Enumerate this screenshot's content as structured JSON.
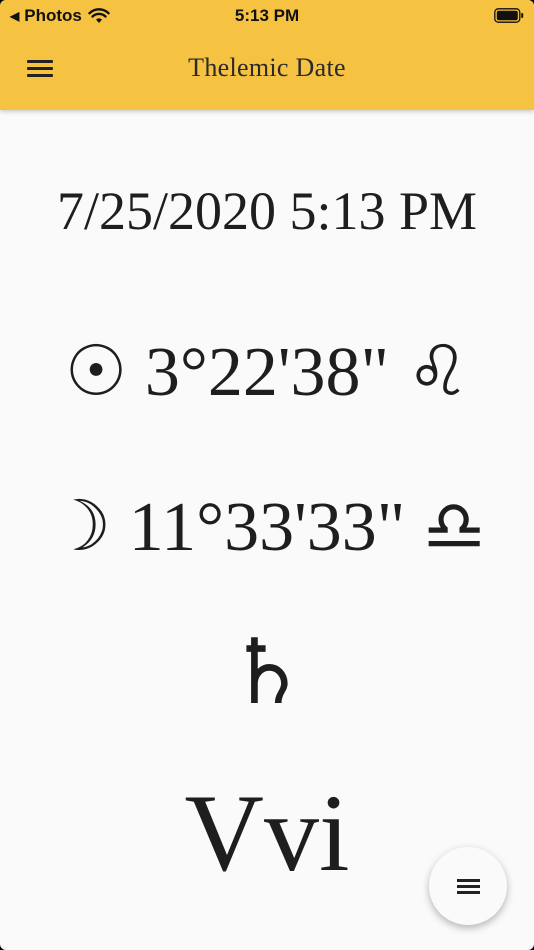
{
  "status_bar": {
    "back_label": "Photos",
    "back_icon": "triangle-left-icon",
    "wifi_icon": "wifi-icon",
    "time": "5:13 PM",
    "battery_icon": "battery-full-icon"
  },
  "app_bar": {
    "title": "Thelemic Date",
    "menu_icon": "hamburger-menu-icon",
    "background_color": "#f5c242"
  },
  "main": {
    "datetime": "7/25/2020 5:13 PM",
    "sun": {
      "symbol": "☉",
      "position": "3°22'38\"",
      "sign_symbol": "♌"
    },
    "moon": {
      "symbol": "☽",
      "position": "11°33'33\"",
      "sign_symbol": "♎"
    },
    "day_symbol": "♄",
    "year": "Vvi"
  },
  "fab": {
    "icon": "menu-lines-icon"
  }
}
